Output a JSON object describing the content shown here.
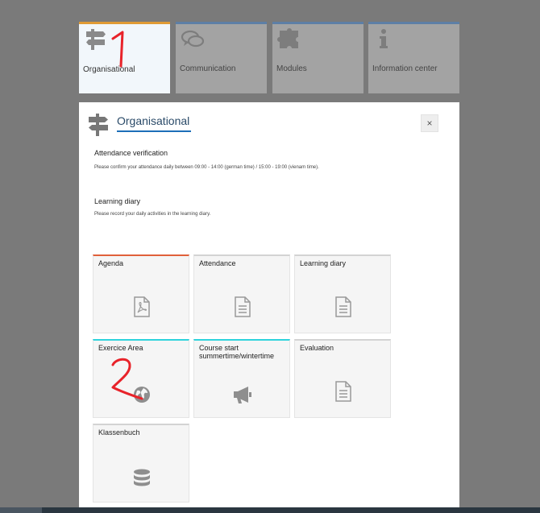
{
  "tabs": [
    {
      "label": "Organisational",
      "icon": "signpost-icon",
      "active": true
    },
    {
      "label": "Communication",
      "icon": "chat-bubbles-icon",
      "active": false
    },
    {
      "label": "Modules",
      "icon": "puzzle-icon",
      "active": false
    },
    {
      "label": "Information center",
      "icon": "info-icon",
      "active": false
    }
  ],
  "panel": {
    "title": "Organisational",
    "close_label": "×",
    "sections": [
      {
        "title": "Attendance verification",
        "text": "Please confirm your attendance daily between 09:00 - 14:00 (german time) / 15:00 - 19:00 (vienam time)."
      },
      {
        "title": "Learning diary",
        "text": "Please record your daily activities in the learning diary."
      }
    ],
    "tiles": [
      {
        "label": "Agenda",
        "icon": "pdf-file-icon",
        "accent": "#e0603a"
      },
      {
        "label": "Attendance",
        "icon": "document-icon",
        "accent": "#d3d3d3"
      },
      {
        "label": "Learning diary",
        "icon": "document-icon",
        "accent": "#d3d3d3"
      },
      {
        "label": "Exercice Area",
        "icon": "globe-icon",
        "accent": "#2fd3dc"
      },
      {
        "label": "Course start summertime/wintertime",
        "icon": "megaphone-icon",
        "accent": "#2fd3dc"
      },
      {
        "label": "Evaluation",
        "icon": "document-icon",
        "accent": "#d3d3d3"
      },
      {
        "label": "Klassenbuch",
        "icon": "database-icon",
        "accent": "#d3d3d3"
      }
    ]
  },
  "annotations": [
    {
      "text": "1",
      "color": "#e8232a"
    },
    {
      "text": "2",
      "color": "#e8232a"
    }
  ]
}
